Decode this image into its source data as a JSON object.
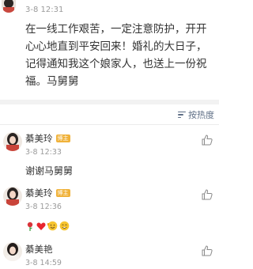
{
  "top_post": {
    "time": "3-8 12:31",
    "lines": [
      "在一线工作艰苦，一定注意防护，开开",
      "心心地直到平安回来！婚礼的大日子，",
      "记得通知我这个娘家人，也送上一份祝",
      "福。马舅舅"
    ]
  },
  "sort": {
    "label": "按热度",
    "icon": "sort-lines-icon"
  },
  "comments": [
    {
      "name": "綦美玲",
      "badge": "博主",
      "time": "3-8 12:33",
      "text": "谢谢马舅舅"
    },
    {
      "name": "綦美玲",
      "badge": "博主",
      "time": "3-8 12:36",
      "emojis": [
        "rose-icon",
        "heart-icon",
        "cheer-emoji-icon",
        "smile-emoji-icon"
      ]
    },
    {
      "name": "綦美艳",
      "time": "3-8 14:59"
    }
  ],
  "colors": {
    "accent_link": "#5f6f86",
    "badge": "#f0b23a",
    "divider": "#f2f2f2"
  }
}
